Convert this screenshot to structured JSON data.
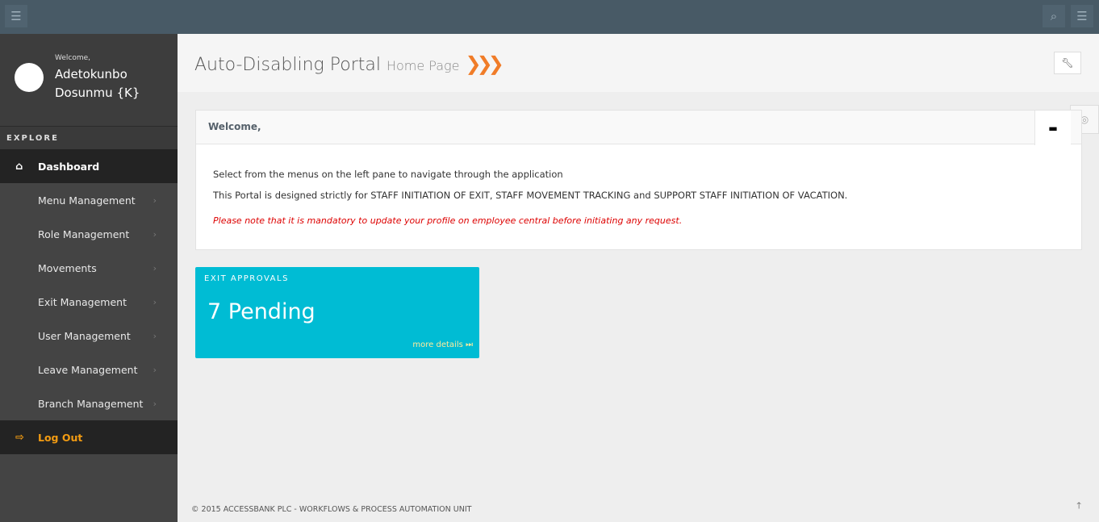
{
  "topbar": {
    "menu_icon": "hamburger-icon",
    "search_icon": "search-icon",
    "right_menu_icon": "hamburger-icon"
  },
  "user": {
    "welcome": "Welcome,",
    "name": "Adetokunbo Dosunmu {K}"
  },
  "sidebar": {
    "section": "EXPLORE",
    "items": [
      {
        "label": "Dashboard",
        "icon": "home-icon",
        "active": true
      },
      {
        "label": "Menu Management"
      },
      {
        "label": "Role Management"
      },
      {
        "label": "Movements"
      },
      {
        "label": "Exit Management"
      },
      {
        "label": "User Management"
      },
      {
        "label": "Leave Management"
      },
      {
        "label": "Branch Management"
      }
    ],
    "logout": "Log Out"
  },
  "header": {
    "title": "Auto-Disabling Portal",
    "subtitle": "Home Page"
  },
  "panel": {
    "title": "Welcome,",
    "line1": "Select from the menus on the left pane to navigate through the application",
    "line2": "This Portal is designed strictly for STAFF INITIATION OF EXIT, STAFF MOVEMENT TRACKING and SUPPORT STAFF INITIATION OF VACATION.",
    "note": "Please note that it is mandatory to update your profile on employee central before initiating any request."
  },
  "tile": {
    "label": "EXIT APPROVALS",
    "value": "7 Pending",
    "more": "more details ⏭",
    "color": "#00bcd4"
  },
  "footer": {
    "text": "© 2015 ACCESSBANK PLC - WORKFLOWS & PROCESS AUTOMATION UNIT"
  },
  "colors": {
    "accent": "#f07c28",
    "topbar": "#485a66"
  }
}
